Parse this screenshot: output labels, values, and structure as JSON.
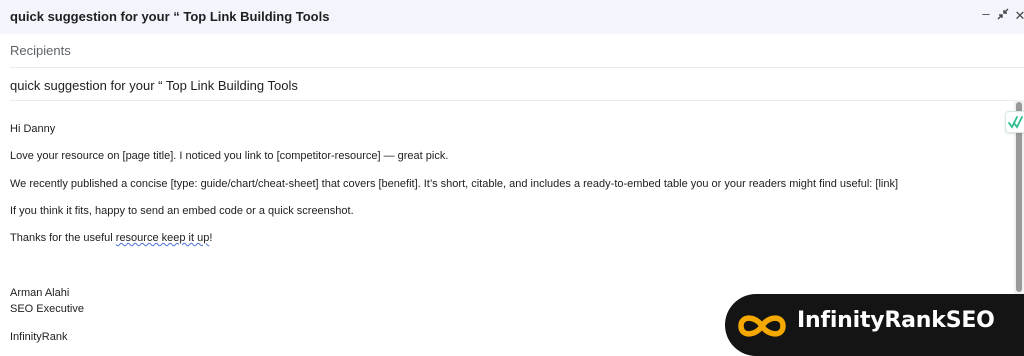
{
  "window": {
    "title": "quick suggestion for your “ Top Link Building Tools",
    "controls": {
      "minimize": "–",
      "expand": "⤢",
      "close": "✕"
    }
  },
  "compose": {
    "recipients_placeholder": "Recipients",
    "subject": "quick suggestion for your “ Top Link Building Tools"
  },
  "message": {
    "greeting": "Hi Danny",
    "line1": "Love your resource on [page title]. I noticed you link to [competitor-resource] — great pick.",
    "line2": "We recently published a concise [type: guide/chart/cheat-sheet] that covers [benefit]. It’s short, citable, and includes a ready-to-embed table you or your readers might find useful: [link]",
    "line3": "If you think it fits, happy to send an embed code or a quick screenshot.",
    "closing_prefix": "Thanks for the useful ",
    "closing_flagged": "resource keep it up",
    "closing_suffix": "!",
    "signature_name": "Arman Alahi",
    "signature_title": "SEO Executive",
    "signature_company": "InfinityRank"
  },
  "overlay": {
    "grammar_icon": "grammar-check-icon",
    "logo_text": "InfinityRankSEO",
    "logo_icon": "infinity-loop-icon",
    "logo_colors": {
      "background": "#141414",
      "loop": "#f5a800",
      "text": "#ffffff"
    }
  }
}
